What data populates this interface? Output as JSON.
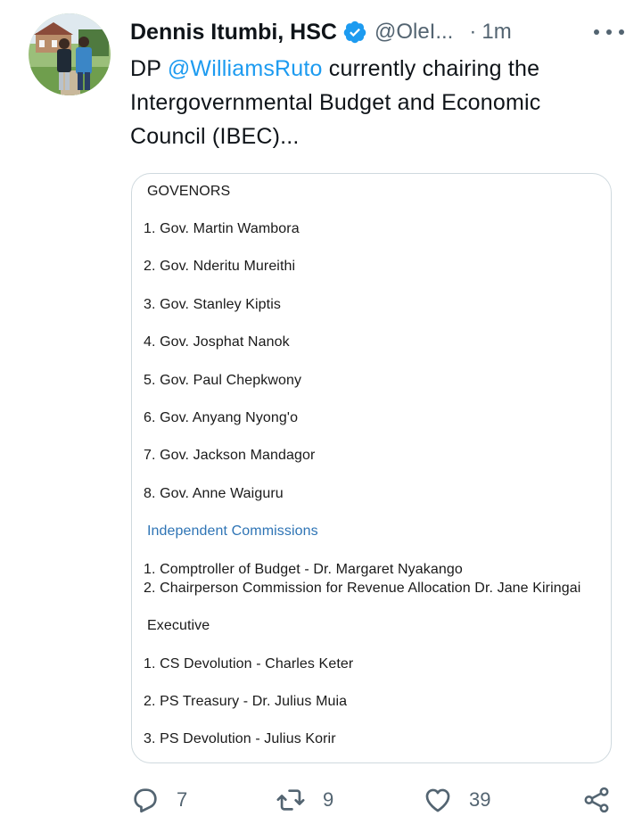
{
  "author": {
    "name": "Dennis Itumbi, HSC",
    "handle": "@OleI...",
    "separator": "·",
    "time": "1m"
  },
  "icons": {
    "verified": "verified-badge-icon",
    "more": "more-options-icon",
    "reply": "reply-icon",
    "retweet": "retweet-icon",
    "like": "like-icon",
    "share": "share-icon"
  },
  "colors": {
    "accent": "#1d9bf0",
    "secondary_text": "#536471",
    "commission_heading": "#2e74b5"
  },
  "tweet": {
    "prefix": "DP ",
    "mention": "@WilliamsRuto",
    "suffix_line1": " currently chairing the",
    "line2": "Intergovernmental Budget and Economic",
    "line3": "Council (IBEC)..."
  },
  "document": {
    "governors_heading": "GOVENORS",
    "governors": [
      "1. Gov. Martin Wambora",
      "2. Gov. Nderitu Mureithi",
      "3. Gov. Stanley Kiptis",
      "4. Gov. Josphat Nanok",
      "5. Gov. Paul Chepkwony",
      "6. Gov. Anyang Nyong'o",
      "7. Gov. Jackson Mandagor",
      "8. Gov. Anne Waiguru"
    ],
    "commissions_heading": "Independent Commissions",
    "commissions": [
      "1. Comptroller of Budget - Dr. Margaret  Nyakango",
      "2. Chairperson Commission for Revenue Allocation  Dr. Jane Kiringai"
    ],
    "executive_heading": "Executive",
    "executive": [
      "1. CS Devolution - Charles Keter",
      "2. PS Treasury - Dr. Julius Muia",
      "3. PS Devolution - Julius Korir"
    ]
  },
  "actions": {
    "replies": "7",
    "retweets": "9",
    "likes": "39"
  }
}
